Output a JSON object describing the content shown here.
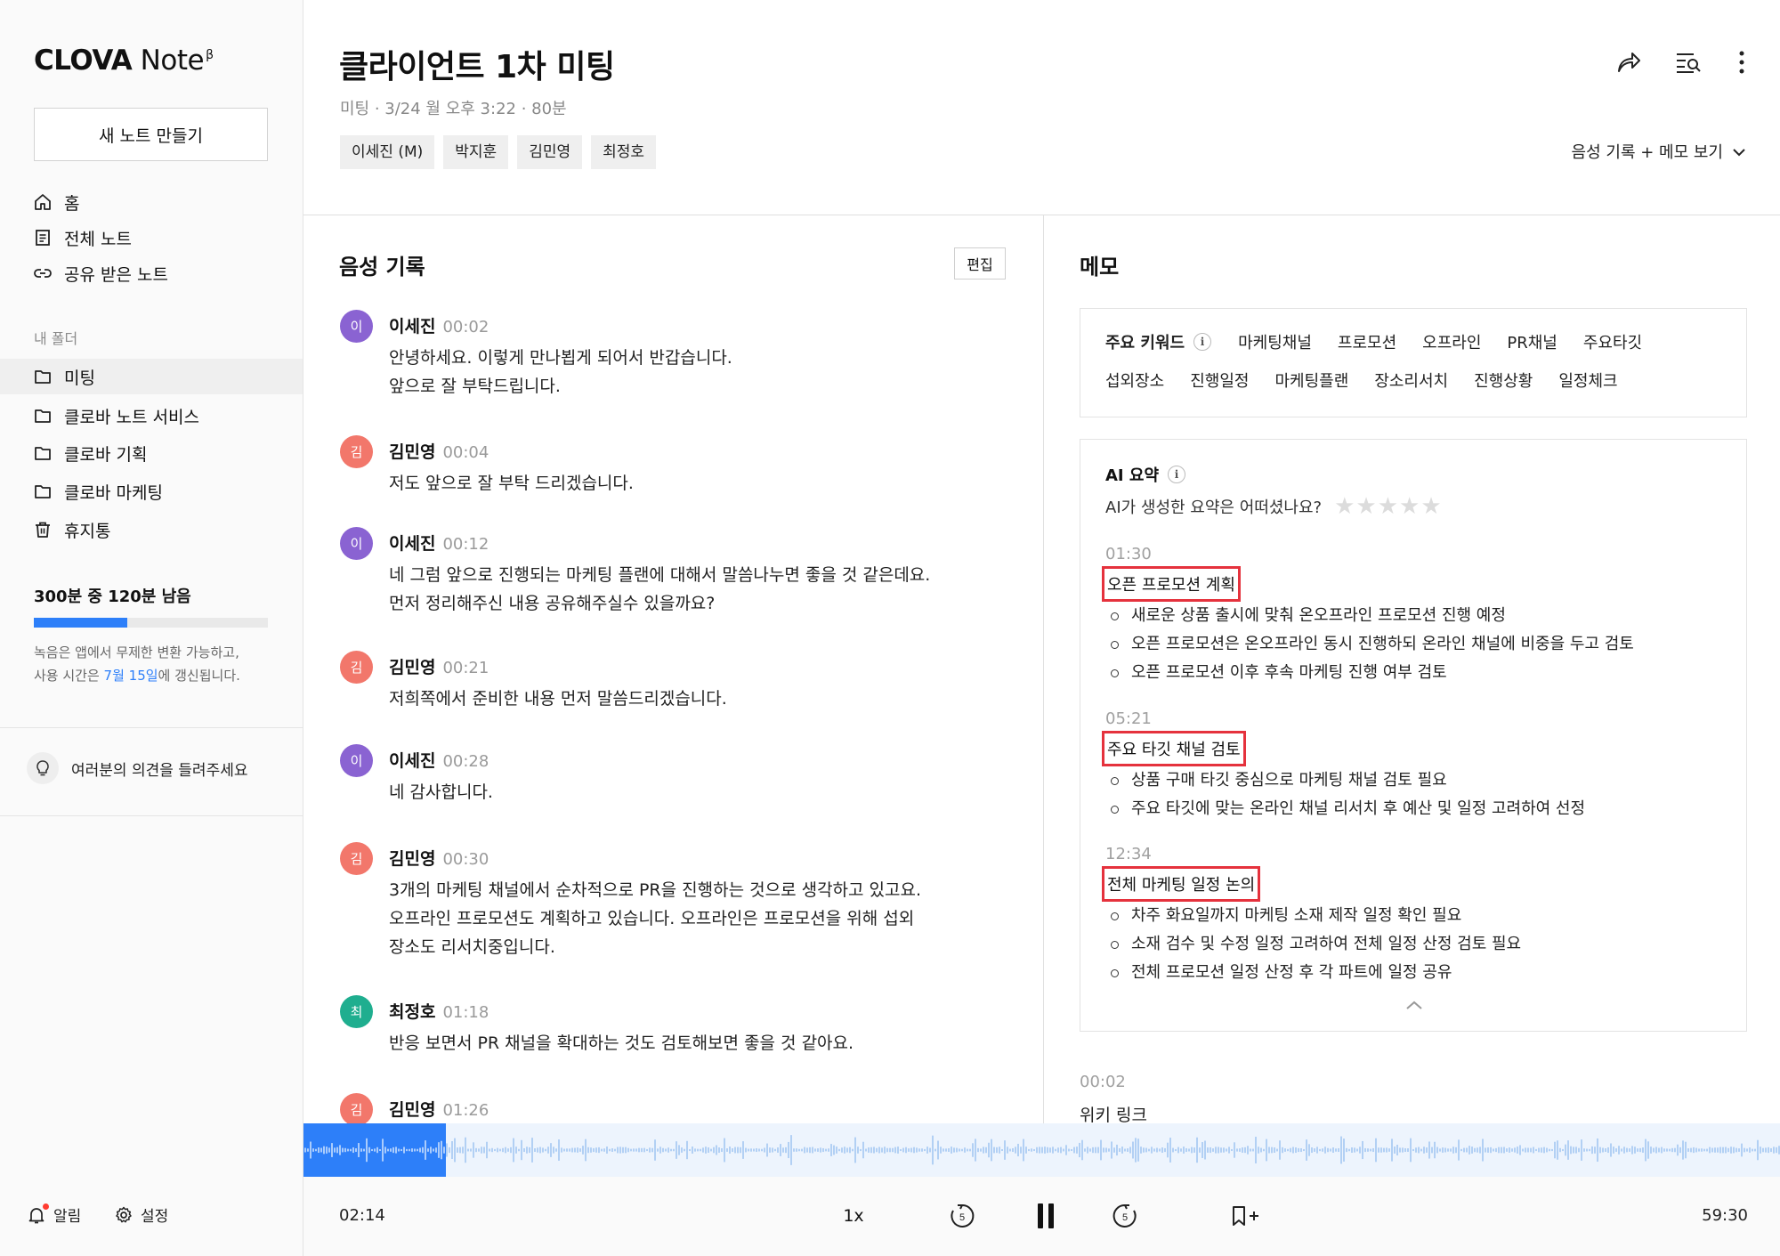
{
  "app": {
    "brand_bold": "CLOVA",
    "brand_light": "Note",
    "brand_sup": "β"
  },
  "sidebar": {
    "new_note": "새 노트 만들기",
    "nav": [
      {
        "label": "홈",
        "icon": "home-icon"
      },
      {
        "label": "전체 노트",
        "icon": "document-icon"
      },
      {
        "label": "공유 받은 노트",
        "icon": "link-icon"
      }
    ],
    "folders_label": "내 폴더",
    "folders": [
      {
        "label": "미팅",
        "icon": "folder-icon",
        "active": true
      },
      {
        "label": "클로바 노트 서비스",
        "icon": "folder-icon"
      },
      {
        "label": "클로바 기획",
        "icon": "folder-icon"
      },
      {
        "label": "클로바 마케팅",
        "icon": "folder-icon"
      },
      {
        "label": "휴지통",
        "icon": "trash-icon"
      }
    ],
    "usage": {
      "title": "300분 중 120분 남음",
      "fraction_remaining": 0.4,
      "desc_1": "녹음은 앱에서 무제한 변환 가능하고,",
      "desc_2_pre": "사용 시간은 ",
      "desc_2_date": "7월 15일",
      "desc_2_post": "에 갱신됩니다."
    },
    "feedback": "여러분의 의견을 들려주세요",
    "alerts": "알림",
    "settings": "설정"
  },
  "header": {
    "title": "클라이언트 1차 미팅",
    "meta": "미팅 · 3/24 월 오후 3:22 · 80분",
    "participants": [
      "이세진 (M)",
      "박지훈",
      "김민영",
      "최정호"
    ],
    "view_mode": "음성 기록 + 메모 보기"
  },
  "transcript": {
    "title": "음성 기록",
    "edit": "편집",
    "utterances": [
      {
        "initial": "이",
        "speaker": "이세진",
        "time": "00:02",
        "color": "#8a63d2",
        "lines": [
          "안녕하세요. 이렇게 만나뵙게 되어서 반갑습니다.",
          "앞으로 잘 부탁드립니다."
        ]
      },
      {
        "initial": "김",
        "speaker": "김민영",
        "time": "00:04",
        "color": "#f2776b",
        "lines": [
          "저도 앞으로 잘 부탁 드리겠습니다."
        ]
      },
      {
        "initial": "이",
        "speaker": "이세진",
        "time": "00:12",
        "color": "#8a63d2",
        "lines": [
          "네 그럼 앞으로 진행되는 마케팅 플랜에 대해서 말씀나누면 좋을 것 같은데요.",
          "먼저 정리해주신 내용 공유해주실수 있을까요?"
        ]
      },
      {
        "initial": "김",
        "speaker": "김민영",
        "time": "00:21",
        "color": "#f2776b",
        "lines": [
          "저희쪽에서 준비한 내용 먼저 말씀드리겠습니다."
        ]
      },
      {
        "initial": "이",
        "speaker": "이세진",
        "time": "00:28",
        "color": "#8a63d2",
        "lines": [
          "네 감사합니다."
        ]
      },
      {
        "initial": "김",
        "speaker": "김민영",
        "time": "00:30",
        "color": "#f2776b",
        "lines": [
          "3개의 마케팅 채널에서 순차적으로 PR을 진행하는 것으로 생각하고 있고요.",
          "오프라인 프로모션도 계획하고 있습니다. 오프라인은 프로모션을 위해 섭외",
          "장소도 리서치중입니다."
        ]
      },
      {
        "initial": "최",
        "speaker": "최정호",
        "time": "01:18",
        "color": "#1fae8f",
        "lines": [
          "반응 보면서 PR 채널을 확대하는 것도 검토해보면 좋을 것 같아요."
        ]
      },
      {
        "initial": "김",
        "speaker": "김민영",
        "time": "01:26",
        "color": "#f2776b",
        "lines": []
      }
    ]
  },
  "memo": {
    "title": "메모",
    "keywords_label": "주요 키워드",
    "keywords_row1": [
      "마케팅채널",
      "프로모션",
      "오프라인",
      "PR채널",
      "주요타깃"
    ],
    "keywords_row2": [
      "섭외장소",
      "진행일정",
      "마케팅플랜",
      "장소리서치",
      "진행상황",
      "일정체크"
    ],
    "ai_label": "AI 요약",
    "ai_question": "AI가 생성한 요약은 어떠셨나요?",
    "rating": 0,
    "rating_max": 5,
    "summaries": [
      {
        "time": "01:30",
        "title": "오픈 프로모션 계획",
        "bullets": [
          "새로운 상품 출시에 맞춰 온오프라인 프로모션 진행 예정",
          "오픈 프로모션은 온오프라인 동시 진행하되 온라인 채널에 비중을 두고 검토",
          "오픈 프로모션 이후 후속 마케팅 진행 여부 검토"
        ]
      },
      {
        "time": "05:21",
        "title": "주요 타깃 채널 검토",
        "bullets": [
          "상품 구매 타깃 중심으로 마케팅 채널 검토 필요",
          "주요 타깃에 맞는 온라인 채널 리서치 후 예산 및 일정 고려하여 선정"
        ]
      },
      {
        "time": "12:34",
        "title": "전체 마케팅 일정 논의",
        "bullets": [
          "차주 화요일까지 마케팅 소재 제작 일정 확인 필요",
          "소재 검수 및 수정 일정 고려하여 전체 일정 산정 검토 필요",
          "전체 프로모션 일정 산정 후 각 파트에 일정 공유"
        ]
      }
    ],
    "note_time": "00:02",
    "note_text": "위키 링크"
  },
  "player": {
    "current": "02:14",
    "total": "59:30",
    "speed": "1x",
    "rewind": "5",
    "forward": "5",
    "colors": {
      "played": "#2d7ff9",
      "unplayed": "#8cb8ef"
    }
  }
}
